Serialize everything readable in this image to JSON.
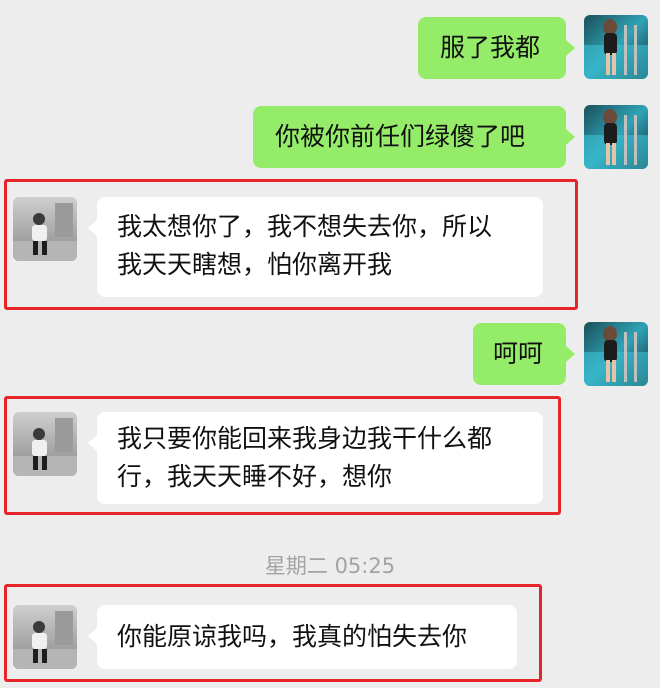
{
  "colors": {
    "sent_bubble": "#95ec69",
    "received_bubble": "#ffffff",
    "highlight_border": "#e8242b",
    "background": "#ededed"
  },
  "messages": [
    {
      "side": "right",
      "text": "服了我都"
    },
    {
      "side": "right",
      "text": "你被你前任们绿傻了吧"
    },
    {
      "side": "left",
      "lines": [
        "我太想你了，我不想失去你，所以",
        "我天天瞎想，怕你离开我"
      ],
      "highlighted": true
    },
    {
      "side": "right",
      "text": "呵呵"
    },
    {
      "side": "left",
      "lines": [
        "我只要你能回来我身边我干什么都",
        "行，我天天睡不好，想你"
      ],
      "highlighted": true
    },
    {
      "side": "left",
      "text": "你能原谅我吗，我真的怕失去你",
      "highlighted": true
    }
  ],
  "timestamp": "星期二 05:25",
  "avatars": {
    "self": "avatar-self-pool-icon",
    "contact": "avatar-contact-person-icon"
  }
}
